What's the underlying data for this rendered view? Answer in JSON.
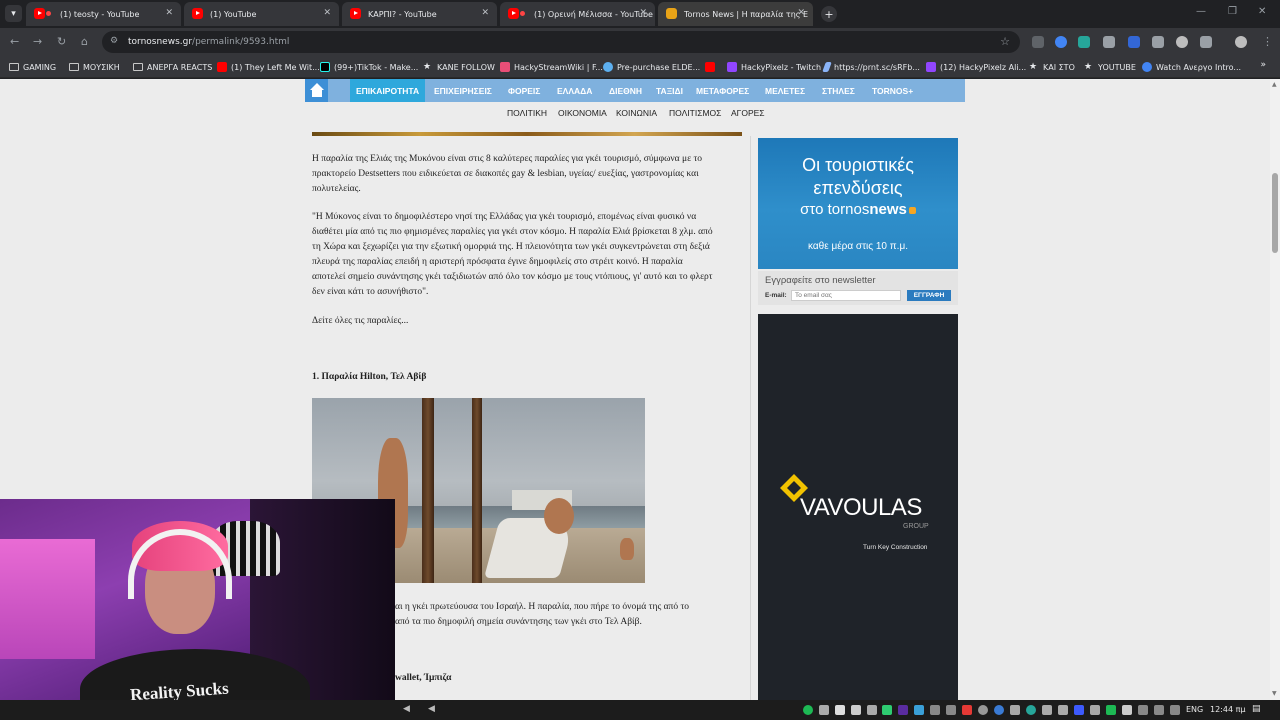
{
  "browser": {
    "tabs": [
      {
        "title": "(1) teosty - YouTube",
        "favicon": "youtube-icon"
      },
      {
        "title": "(1) YouTube",
        "favicon": "youtube-icon"
      },
      {
        "title": "ΚΑΡΠΙ? - YouTube",
        "favicon": "youtube-icon"
      },
      {
        "title": "(1) Ορεινή Μέλισσα - YouTube",
        "favicon": "youtube-icon"
      },
      {
        "title": "Tornos News | Η παραλία της Ε",
        "favicon": "tornos-icon"
      }
    ],
    "url_domain": "tornosnews.gr",
    "url_path": "/permalink/9593.html",
    "bookmarks": [
      {
        "label": "GAMING",
        "icon": "folder-icon"
      },
      {
        "label": "ΜΟΥΣΙΚΗ",
        "icon": "folder-icon"
      },
      {
        "label": "ΑΝΕΡΓΑ REACTS",
        "icon": "folder-icon"
      },
      {
        "label": "(1) They Left Me Wit...",
        "icon": "youtube-icon"
      },
      {
        "label": "(99+)TikTok - Make...",
        "icon": "tiktok-icon"
      },
      {
        "label": "KANE FOLLOW",
        "icon": "star-icon"
      },
      {
        "label": "HackyStreamWiki | F...",
        "icon": "wiki-icon"
      },
      {
        "label": "Pre-purchase ELDE...",
        "icon": "steam-icon"
      },
      {
        "label": "",
        "icon": "youtube-icon"
      },
      {
        "label": "HackyPixelz - Twitch",
        "icon": "twitch-icon"
      },
      {
        "label": "https://prnt.sc/sRFb...",
        "icon": "lightshot-icon"
      },
      {
        "label": "(12) HackyPixelz Ali...",
        "icon": "twitch-icon"
      },
      {
        "label": "ΚΑΙ ΣΤΟ",
        "icon": "star-icon"
      },
      {
        "label": "YOUTUBE",
        "icon": "star-icon"
      },
      {
        "label": "Watch Ανεργο Intro...",
        "icon": "watch-icon"
      }
    ]
  },
  "site": {
    "main_nav": [
      "ΕΠΙΚΑΙΡΟΤΗΤΑ",
      "ΕΠΙΧΕΙΡΗΣΕΙΣ",
      "ΦΟΡΕΙΣ",
      "ΕΛΛΑΔΑ",
      "ΔΙΕΘΝΗ",
      "ΤΑΞΙΔΙ",
      "ΜΕΤΑΦΟΡΕΣ",
      "ΜΕΛΕΤΕΣ",
      "ΣΤΗΛΕΣ",
      "TORNOS+"
    ],
    "sub_nav": [
      "ΠΟΛΙΤΙΚΗ",
      "ΟΙΚΟΝΟΜΙΑ",
      "ΚΟΙΝΩΝΙΑ",
      "ΠΟΛΙΤΙΣΜΟΣ",
      "ΑΓΟΡΕΣ"
    ]
  },
  "article": {
    "p1_l1": "Η παραλία της Ελιάς της Μυκόνου είναι στις 8 καλύτερες παραλίες για γκέι τουρισμό, σύμφωνα με το",
    "p1_l2": "πρακτορείο Destsetters που ειδικεύεται σε διακοπές gay & lesbian, υγείας/ ευεξίας, γαστρονομίας και",
    "p1_l3": "πολυτελείας.",
    "p2_l1": "\"Η Μύκονος είναι το δημοφιλέστερο νησί της Ελλάδας για γκέι τουρισμό, επομένως είναι φυσικό να",
    "p2_l2": "διαθέτει μία από τις πιο φημισμένες παραλίες για γκέι στον κόσμο. Η παραλία Ελιά βρίσκεται 8 χλμ. από",
    "p2_l3": "τη Χώρα και ξεχωρίζει για την εξωτική ομορφιά της. Η πλειονότητα των γκέι συγκεντρώνεται στη δεξιά",
    "p2_l4": "πλευρά της παραλίας επειδή η αριστερή πρόσφατα έγινε δημοφιλείς στο στρέιτ κοινό. Η παραλία",
    "p2_l5": "αποτελεί σημείο συνάντησης γκέι ταξιδιωτών από όλο τον κόσμο με τους ντόπιους, γι' αυτό και το φλερτ",
    "p2_l6": "δεν είναι κάτι το ασυνήθιστο\".",
    "p3": "Δείτε όλες τις παραλίες...",
    "h1": "1. Παραλία Hilton, Τελ Αβίβ",
    "p4_l1": "αι η γκέι πρωτεύουσα του Ισραήλ. Η παραλία, που πήρε το όνομά της από το",
    "p4_l2": "από τα πιο δημοφιλή σημεία συνάντησης των γκέι στο Τελ Αβίβ.",
    "h2": "wallet, Ίμπιζα"
  },
  "sidebar": {
    "ad1": {
      "line1": "Οι τουριστικές",
      "line2": "επενδύσεις",
      "line3_pre": "στο tornos",
      "line3_bold": "news",
      "line4": "καθε μέρα στις 10 π.μ."
    },
    "newsletter": {
      "title": "Εγγραφείτε στο newsletter",
      "email_label": "E-mail:",
      "email_placeholder": "Το email σας",
      "submit": "ΕΓΓΡΑΦΗ"
    },
    "ad2": {
      "brand": "VAVOULAS",
      "group": "GROUP",
      "tagline": "Turn Key Construction"
    }
  },
  "webcam": {
    "shirt_text": "Reality Sucks"
  },
  "taskbar": {
    "language": "ENG",
    "time": "12:44 πμ"
  },
  "colors": {
    "nav_bar": "#7fb1de",
    "nav_active": "#2ea8dc",
    "accent_orange": "#f5a623"
  }
}
